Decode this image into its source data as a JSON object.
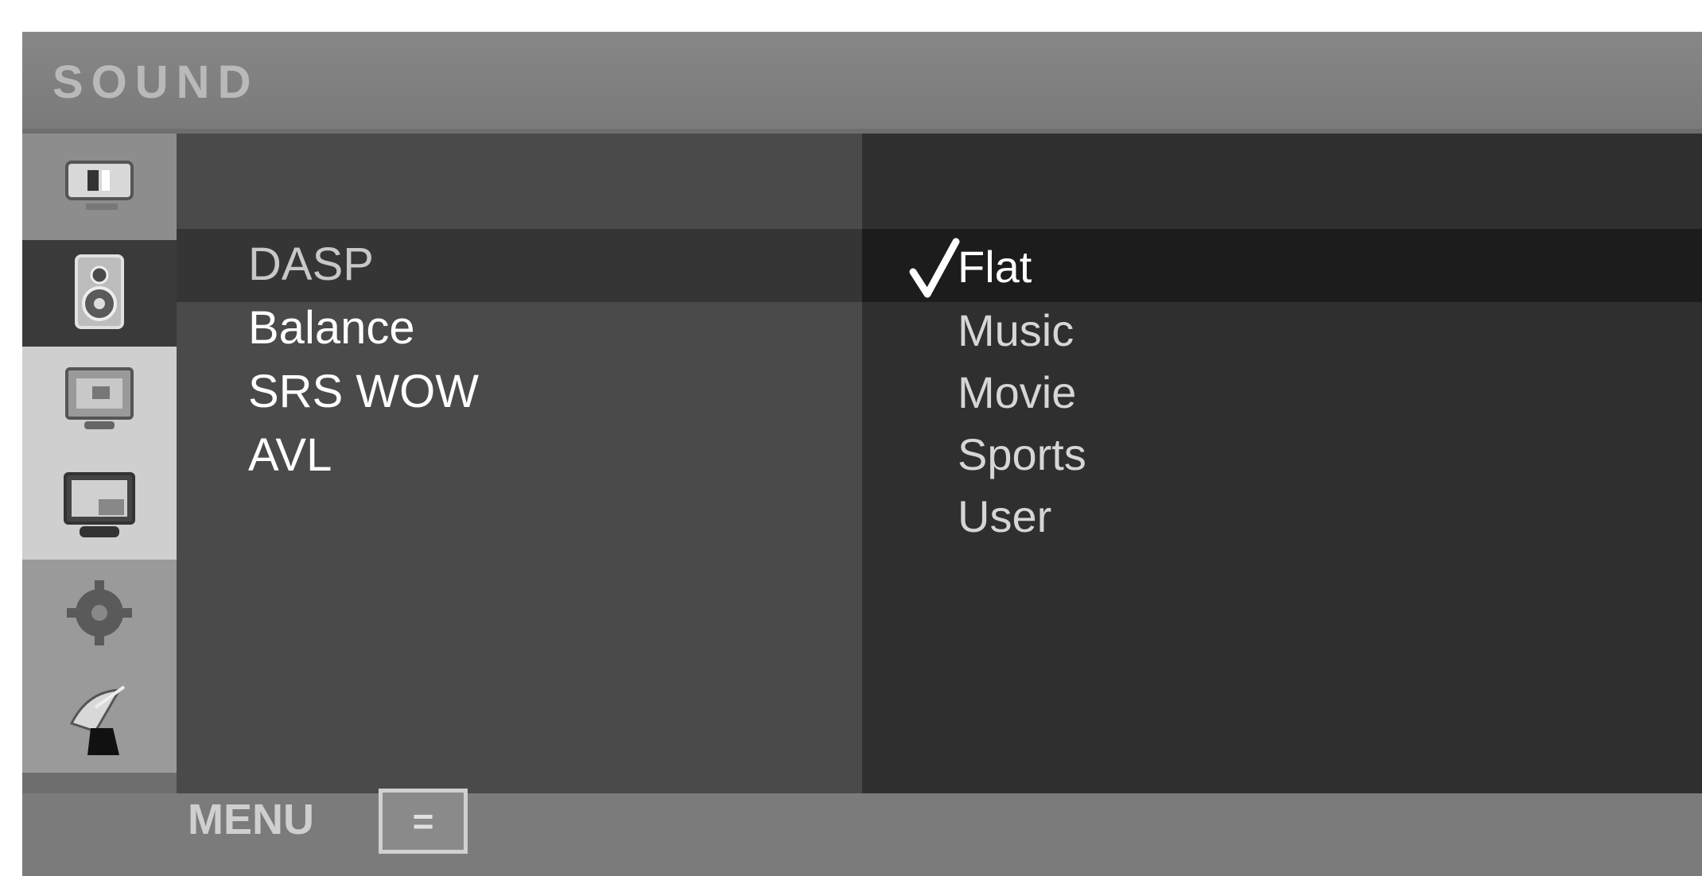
{
  "window": {
    "title": "SOUND"
  },
  "sidebar": {
    "items": [
      {
        "icon": "input-icon",
        "state": "inactive"
      },
      {
        "icon": "speaker-icon",
        "state": "active"
      },
      {
        "icon": "picture-icon",
        "state": "inactive"
      },
      {
        "icon": "screen-icon",
        "state": "inactive"
      },
      {
        "icon": "setup-gear-icon",
        "state": "inactive"
      },
      {
        "icon": "satellite-dish-icon",
        "state": "inactive"
      }
    ]
  },
  "menu": {
    "items": [
      {
        "label": "DASP"
      },
      {
        "label": "Balance"
      },
      {
        "label": "SRS WOW"
      },
      {
        "label": "AVL"
      }
    ],
    "selected": "DASP"
  },
  "options": {
    "items": [
      {
        "label": "Flat"
      },
      {
        "label": "Music"
      },
      {
        "label": "Movie"
      },
      {
        "label": "Sports"
      },
      {
        "label": "User"
      }
    ],
    "current": "Flat"
  },
  "footer": {
    "menu_label": "MENU",
    "menu_key_symbol": "="
  },
  "colors": {
    "panel_dark": "#2f2f2f",
    "panel_mid": "#4a4a4a",
    "frame": "#6e6e6e"
  }
}
